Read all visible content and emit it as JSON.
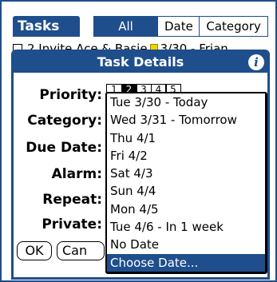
{
  "header": {
    "app_title": "Tasks",
    "tabs": [
      "All",
      "Date",
      "Category"
    ],
    "active_tab": "All"
  },
  "background_row": {
    "text_before": "2 Invite Ace & Basie",
    "text_after": "3/30 - Frian"
  },
  "dialog": {
    "title": "Task Details",
    "info_icon": "info-icon",
    "fields": {
      "priority_label": "Priority:",
      "category_label": "Category:",
      "due_date_label": "Due Date:",
      "alarm_label": "Alarm:",
      "repeat_label": "Repeat:",
      "private_label": "Private:"
    },
    "priority_values": [
      "1",
      "2",
      "3",
      "4",
      "5"
    ],
    "priority_selected": "2",
    "ok_label": "OK",
    "cancel_label": "Can"
  },
  "date_popup": {
    "items": [
      "Tue 3/30 - Today",
      "Wed 3/31 - Tomorrow",
      "Thu 4/1",
      "Fri 4/2",
      "Sat 4/3",
      "Sun 4/4",
      "Mon 4/5",
      "Tue 4/6 - In 1 week",
      "No Date",
      "Choose Date..."
    ],
    "selected_index": 9
  },
  "colors": {
    "accent": "#1f4e8c",
    "note_yellow": "#f2d200"
  }
}
